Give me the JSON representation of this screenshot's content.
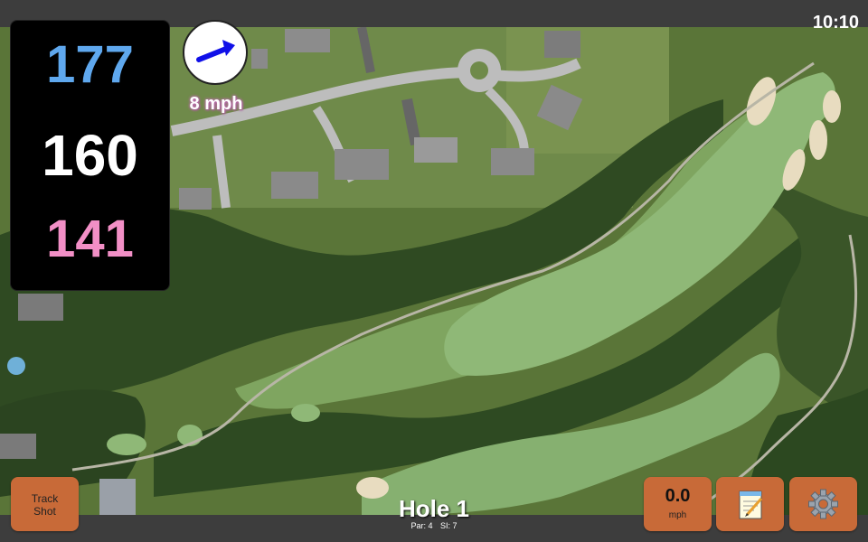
{
  "clock": "10:10",
  "distances": {
    "back": "177",
    "middle": "160",
    "front": "141",
    "colors": {
      "back": "#5fa8ee",
      "middle": "#ffffff",
      "front": "#f28fc6"
    }
  },
  "wind": {
    "icon": "wind-arrow-icon",
    "speed_label": "8 mph"
  },
  "buttons": {
    "track_shot_line1": "Track",
    "track_shot_line2": "Shot",
    "wind_value": "0.0",
    "wind_unit": "mph",
    "notes_icon": "notepad-icon",
    "settings_icon": "gear-icon"
  },
  "hole": {
    "title": "Hole 1",
    "par": "Par: 4",
    "si": "SI: 7"
  },
  "colors": {
    "button": "#c86a38",
    "bar": "#3d3d3d"
  }
}
